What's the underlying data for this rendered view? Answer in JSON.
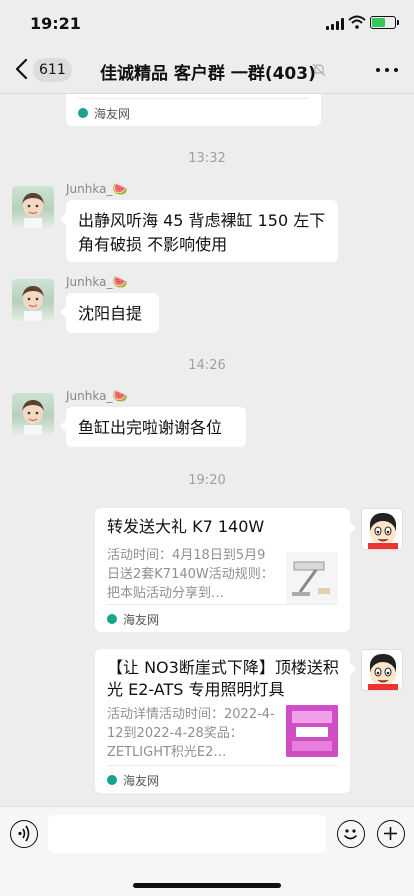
{
  "status_bar": {
    "time": "19:21"
  },
  "nav": {
    "unread_count": "611",
    "title": "佳诚精品 客户群 一群(403)"
  },
  "messages": {
    "top_card": {
      "source": "海友网"
    },
    "ts1": "13:32",
    "m1": {
      "sender": "Junhka_🍉",
      "text": "出静风听海 45 背虑裸缸 150 左下\n角有破损 不影响使用"
    },
    "m2": {
      "sender": "Junhka_🍉",
      "text": "沈阳自提"
    },
    "ts2": "14:26",
    "m3": {
      "sender": "Junhka_🍉",
      "text": "鱼缸出完啦谢谢各位"
    },
    "ts3": "19:20",
    "card1": {
      "title": "转发送大礼 K7 140W",
      "desc": "活动时间：4月18日到5月9日送2套K7140W活动规则：把本贴活动分享到…",
      "source": "海友网"
    },
    "card2": {
      "title": "【让 NO3断崖式下降】顶楼送积光 E2-ATS 专用照明灯具",
      "desc": "活动详情活动时间：2022-4-12到2022-4-28奖品：ZETLIGHT积光E2…",
      "source": "海友网"
    }
  },
  "colors": {
    "background": "#ededed",
    "bubble": "#ffffff",
    "source_accent": "#1aa38a",
    "battery": "#34c759"
  }
}
